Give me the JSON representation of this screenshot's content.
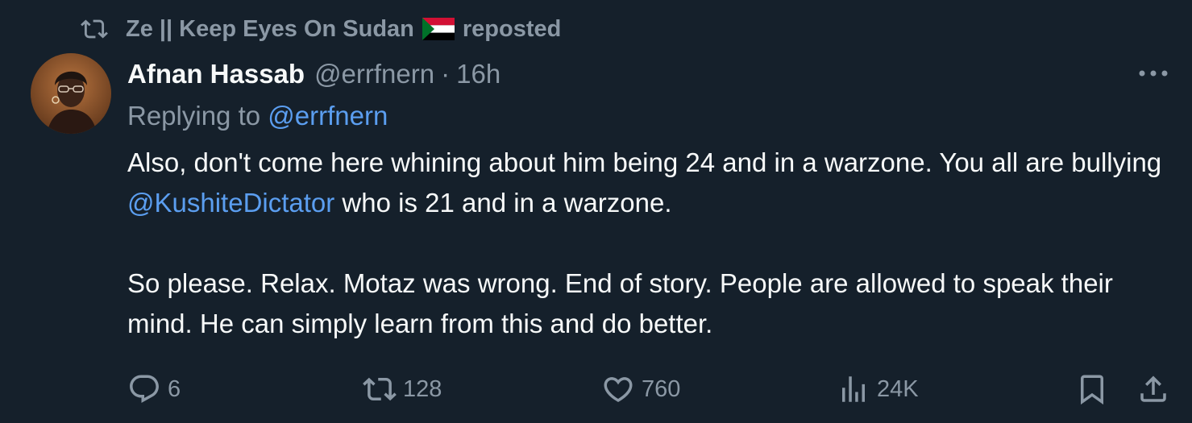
{
  "repost": {
    "icon": "repost-icon",
    "user_name": "Ze || Keep Eyes On Sudan",
    "flag": "sudan-flag",
    "suffix": "reposted"
  },
  "tweet": {
    "display_name": "Afnan Hassab",
    "handle": "@errfnern",
    "separator": "·",
    "time": "16h",
    "replying_to_label": "Replying to",
    "replying_to_handle": "@errfnern",
    "body_line1_prefix": "Also, don't come here whining about him being 24 and in a warzone. You all are bullying ",
    "body_mention": "@KushiteDictator",
    "body_line1_suffix": " who is 21 and in a warzone.",
    "body_paragraph2": "So please. Relax. Motaz was wrong. End of story. People are allowed to speak their mind. He can simply learn from this and do better."
  },
  "actions": {
    "reply_count": "6",
    "repost_count": "128",
    "like_count": "760",
    "views_count": "24K"
  },
  "colors": {
    "background": "#15202b",
    "text_primary": "#f7f9f9",
    "text_secondary": "#8b98a5",
    "link": "#5b9ef0"
  }
}
